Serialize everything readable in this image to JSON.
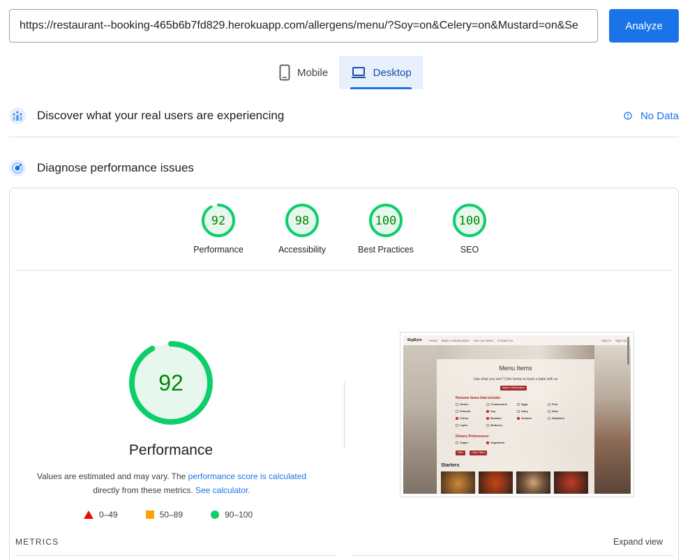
{
  "url_bar": {
    "value": "https://restaurant--booking-465b6b7fd829.herokuapp.com/allergens/menu/?Soy=on&Celery=on&Mustard=on&Se",
    "analyze_label": "Analyze"
  },
  "device_tabs": [
    {
      "label": "Mobile",
      "icon": "mobile-phone-icon",
      "active": false
    },
    {
      "label": "Desktop",
      "icon": "laptop-icon",
      "active": true
    }
  ],
  "field_data": {
    "title": "Discover what your real users are experiencing",
    "status_label": "No Data"
  },
  "lab_data": {
    "title": "Diagnose performance issues"
  },
  "category_scores": [
    {
      "label": "Performance",
      "score": "92",
      "value": 92
    },
    {
      "label": "Accessibility",
      "score": "98",
      "value": 98
    },
    {
      "label": "Best Practices",
      "score": "100",
      "value": 100
    },
    {
      "label": "SEO",
      "score": "100",
      "value": 100
    }
  ],
  "performance": {
    "score": "92",
    "value": 92,
    "title": "Performance",
    "note_prefix": "Values are estimated and may vary. The ",
    "note_link": "performance score is calculated",
    "note_middle": "directly from these metrics. ",
    "note_calc_link": "See calculator."
  },
  "legend": [
    {
      "range": "0–49",
      "shape": "triangle",
      "color": "#eb0f00"
    },
    {
      "range": "50–89",
      "shape": "square",
      "color": "#ffa400"
    },
    {
      "range": "90–100",
      "shape": "circle",
      "color": "#0cce6b"
    }
  ],
  "metrics": {
    "label": "METRICS",
    "expand_label": "Expand view"
  },
  "colors": {
    "good": "#0cce6b",
    "good_text": "#008800",
    "good_fill": "#e8f7ee",
    "accent": "#1a73e8"
  },
  "preview": {
    "brand": "BigByte",
    "nav_links": [
      "Home",
      "Make a Reservation",
      "See our Menu",
      "Contact Us"
    ],
    "nav_right": [
      "Sign In",
      "Sign Up"
    ],
    "heading": "Menu Items",
    "subheading": "Like what you see? Click below to book a table with us",
    "reserve_btn": "Make a Reservation",
    "remove_heading": "Remove items that include:",
    "allergens": [
      {
        "name": "Gluten",
        "checked": false
      },
      {
        "name": "Crustaceans",
        "checked": false
      },
      {
        "name": "Eggs",
        "checked": false
      },
      {
        "name": "Fish",
        "checked": false
      },
      {
        "name": "Peanuts",
        "checked": false
      },
      {
        "name": "Soy",
        "checked": true
      },
      {
        "name": "Dairy",
        "checked": false
      },
      {
        "name": "Nuts",
        "checked": false
      },
      {
        "name": "Celery",
        "checked": true
      },
      {
        "name": "Mustard",
        "checked": true
      },
      {
        "name": "Sesame",
        "checked": true
      },
      {
        "name": "Sulphites",
        "checked": false
      },
      {
        "name": "Lupin",
        "checked": false
      },
      {
        "name": "Molluscs",
        "checked": false
      }
    ],
    "diet_heading": "Dietary Preferences:",
    "diet": [
      {
        "name": "Vegan",
        "checked": false
      },
      {
        "name": "Vegetarian",
        "checked": true
      }
    ],
    "filter_btn": "Filter",
    "clear_btn": "Clear Filters",
    "starters": "Starters"
  }
}
